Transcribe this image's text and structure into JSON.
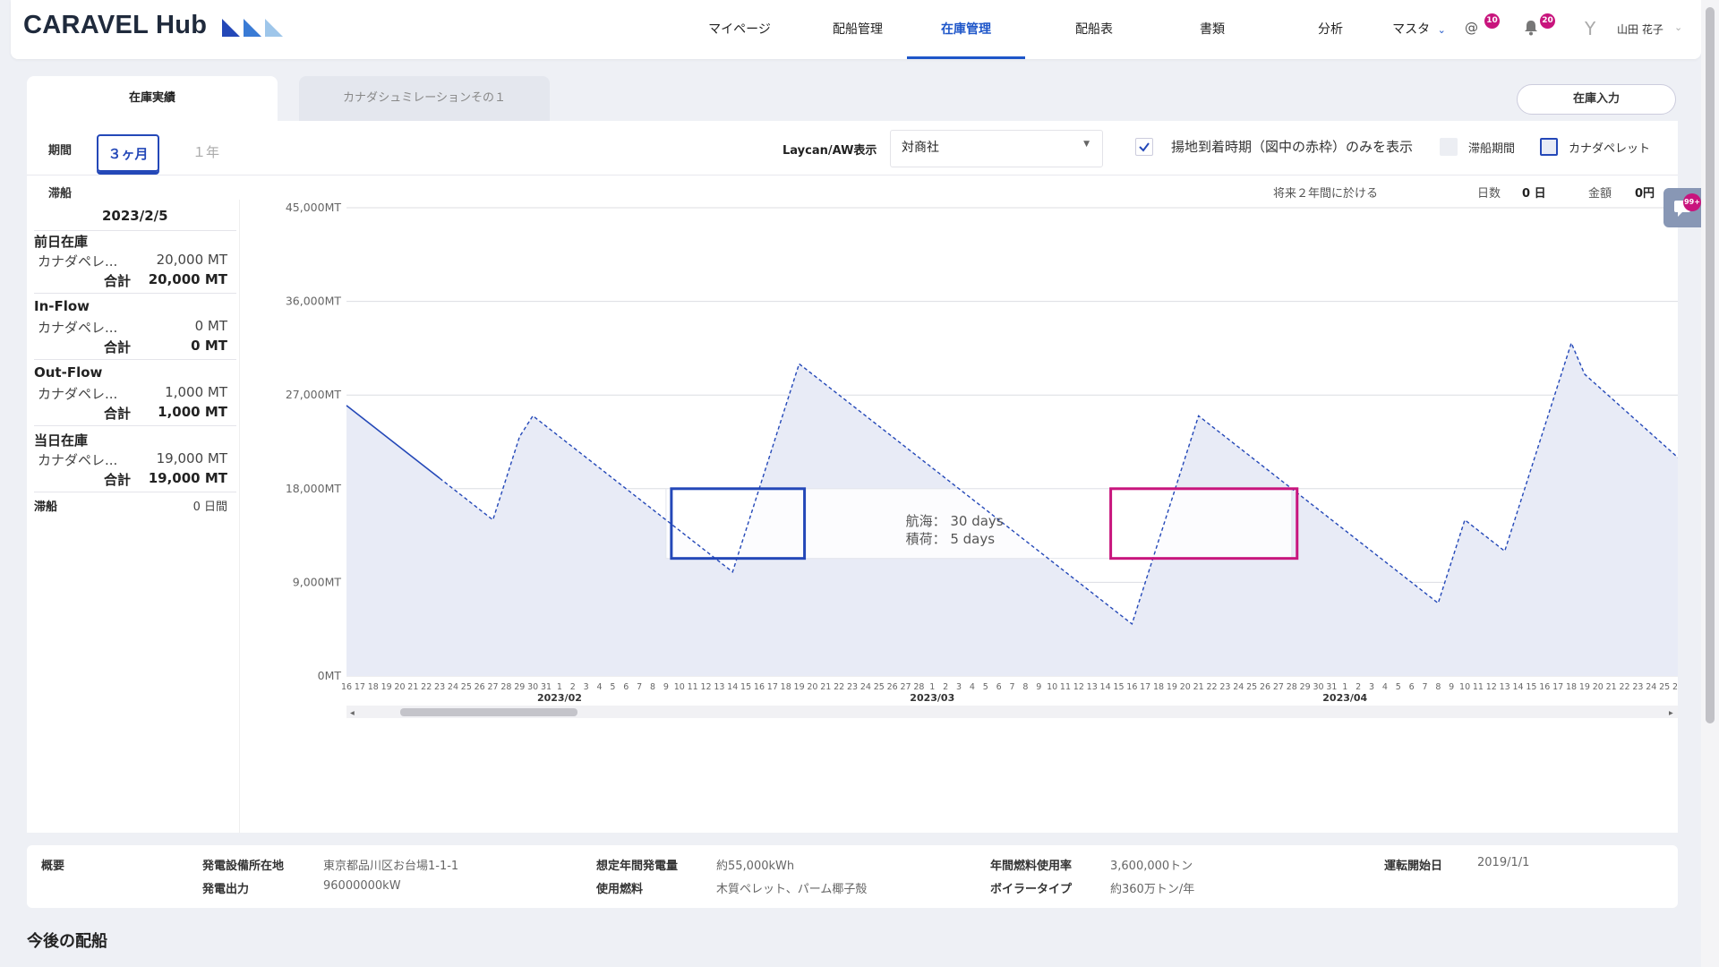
{
  "app": {
    "logo": "CARAVEL Hub"
  },
  "nav": {
    "items": [
      "マイページ",
      "配船管理",
      "在庫管理",
      "配船表",
      "書類",
      "分析"
    ],
    "active": "在庫管理",
    "master": "マスタ",
    "mention_badge": "10",
    "bell_badge": "20",
    "user_initial": "Y",
    "user_name": "山田 花子"
  },
  "tabs": {
    "tab1": "在庫実績",
    "tab2": "カナダシュミレーションその１",
    "stock_input": "在庫入力"
  },
  "filters": {
    "period_label": "期間",
    "period_selected": "３ヶ月",
    "period_other": "１年",
    "laycan_label": "Laycan/AW表示",
    "laycan_value": "対商社",
    "check_arrival": "揚地到着時期（図中の赤枠）のみを表示",
    "legend_demurrage": "滞船期間",
    "legend_pellet": "カナダペレット"
  },
  "stats": {
    "section": "滞船",
    "future_label": "将来２年間に於ける",
    "days_label": "日数",
    "days_value": "0 日",
    "amount_label": "金額",
    "amount_value": "0円"
  },
  "summary": {
    "date": "2023/2/5",
    "prev_stock": "前日在庫",
    "prev_item": "カナダペレ...",
    "prev_item_value": "20,000 MT",
    "total": "合計",
    "prev_total": "20,000 MT",
    "inflow": "In-Flow",
    "inflow_item": "カナダペレ...",
    "inflow_item_value": "0 MT",
    "inflow_total": "0 MT",
    "outflow": "Out-Flow",
    "outflow_item": "カナダペレ...",
    "outflow_item_value": "1,000 MT",
    "outflow_total": "1,000 MT",
    "today_stock": "当日在庫",
    "today_item": "カナダペレ...",
    "today_item_value": "19,000 MT",
    "today_total": "19,000 MT",
    "demurrage": "滞船",
    "demurrage_value": "0 日間"
  },
  "chart_data": {
    "type": "area",
    "ylim": [
      0,
      45000
    ],
    "y_ticks": [
      "0MT",
      "9,000MT",
      "18,000MT",
      "27,000MT",
      "36,000MT",
      "45,000MT"
    ],
    "x_start": "2023-01-16",
    "x_end": "2023-04-26",
    "month_labels": [
      "2023/02",
      "2023/03",
      "2023/04"
    ],
    "series": [
      {
        "values": [
          [
            "2023-01-16",
            26000
          ],
          [
            "2023-01-23",
            19000
          ],
          [
            "2023-01-27",
            15000
          ],
          [
            "2023-01-29",
            23000
          ],
          [
            "2023-01-30",
            25000
          ],
          [
            "2023-02-14",
            10000
          ],
          [
            "2023-02-19",
            30000
          ],
          [
            "2023-03-16",
            5000
          ],
          [
            "2023-03-21",
            25000
          ],
          [
            "2023-04-08",
            7000
          ],
          [
            "2023-04-10",
            15000
          ],
          [
            "2023-04-13",
            12000
          ],
          [
            "2023-04-18",
            32000
          ],
          [
            "2023-04-19",
            29000
          ],
          [
            "2023-04-26",
            21000
          ]
        ]
      }
    ],
    "solid_until": "2023-01-23",
    "laycan_box": {
      "x": [
        "2023-02-09",
        "2023-02-19"
      ],
      "y": [
        11300,
        18000
      ],
      "color": "#2448b8"
    },
    "arrival_box": {
      "x": [
        "2023-03-14",
        "2023-03-28"
      ],
      "y": [
        11300,
        18000
      ],
      "color": "#c8157d"
    },
    "annotation": [
      "航海：  30 days",
      "積荷：   5 days"
    ]
  },
  "info": {
    "title": "概要",
    "location_label": "発電設備所在地",
    "location_value": "東京都品川区お台場1-1-1",
    "output_label": "発電出力",
    "output_value": "96000000kW",
    "annual_gen_label": "想定年間発電量",
    "annual_gen_value": "約55,000kWh",
    "fuel_label": "使用燃料",
    "fuel_value": "木質ペレット、パーム椰子殻",
    "annual_fuel_label": "年間燃料使用率",
    "annual_fuel_value": "3,600,000トン",
    "boiler_label": "ボイラータイプ",
    "boiler_value": "約360万トン/年",
    "start_label": "運転開始日",
    "start_value": "2019/1/1"
  },
  "future_section": "今後の配船",
  "colors": {
    "accent": "#1e56c9",
    "magenta": "#c8157d",
    "fill": "#e8ebf6",
    "line": "#2448b8"
  }
}
